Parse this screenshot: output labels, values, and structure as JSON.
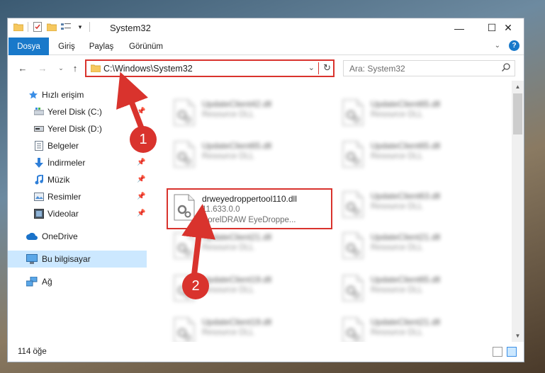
{
  "window": {
    "title": "System32",
    "controls": {
      "minimize": "—",
      "maximize": "☐",
      "close": "✕"
    }
  },
  "ribbon": {
    "tabs": [
      {
        "label": "Dosya",
        "active": true
      },
      {
        "label": "Giriş",
        "active": false
      },
      {
        "label": "Paylaş",
        "active": false
      },
      {
        "label": "Görünüm",
        "active": false
      }
    ],
    "help": "?"
  },
  "address_bar": {
    "path": "C:\\Windows\\System32",
    "dropdown": "⌄",
    "refresh": "↻"
  },
  "search": {
    "placeholder": "Ara: System32"
  },
  "sidebar": {
    "items": [
      {
        "label": "Hızlı erişim",
        "icon": "star-icon"
      },
      {
        "label": "Yerel Disk (C:)",
        "icon": "drive-icon",
        "pinned": true
      },
      {
        "label": "Yerel Disk (D:)",
        "icon": "drive-icon"
      },
      {
        "label": "Belgeler",
        "icon": "documents-icon",
        "pinned": true
      },
      {
        "label": "İndirmeler",
        "icon": "downloads-icon",
        "pinned": true
      },
      {
        "label": "Müzik",
        "icon": "music-icon",
        "pinned": true
      },
      {
        "label": "Resimler",
        "icon": "pictures-icon",
        "pinned": true
      },
      {
        "label": "Videolar",
        "icon": "videos-icon",
        "pinned": true
      },
      {
        "label": "OneDrive",
        "icon": "cloud-icon"
      },
      {
        "label": "Bu bilgisayar",
        "icon": "computer-icon",
        "selected": true
      },
      {
        "label": "Ağ",
        "icon": "network-icon"
      }
    ]
  },
  "files": {
    "left_column": [
      {
        "name": "UpdateClient42.dll",
        "desc": "Resource DLL"
      },
      {
        "name": "UpdateClient65.dll",
        "desc": "Resource DLL"
      },
      {
        "name": "drweyedroppertool110.dll",
        "desc": "11.633.0.0",
        "desc2": "CorelDRAW EyeDroppe...",
        "highlighted": true
      },
      {
        "name": "UpdateClient21.dll",
        "desc": "Resource DLL"
      },
      {
        "name": "UpdateClient19.dll",
        "desc": "Resource DLL"
      },
      {
        "name": "UpdateClient19.dll",
        "desc": "Resource DLL"
      }
    ],
    "right_column": [
      {
        "name": "UpdateClient65.dll",
        "desc": "Resource DLL"
      },
      {
        "name": "UpdateClient65.dll",
        "desc": "Resource DLL"
      },
      {
        "name": "UpdateClient63.dll",
        "desc": "Resource DLL"
      },
      {
        "name": "UpdateClient21.dll",
        "desc": "Resource DLL"
      },
      {
        "name": "UpdateClient65.dll",
        "desc": "Resource DLL"
      },
      {
        "name": "UpdateClient21.dll",
        "desc": "Resource DLL"
      }
    ]
  },
  "status": {
    "item_count": "114 öğe"
  },
  "annotations": [
    {
      "label": "1",
      "color": "#d9332d"
    },
    {
      "label": "2",
      "color": "#d9332d"
    }
  ],
  "colors": {
    "accent": "#1979ca",
    "annotation": "#d9332d",
    "selection": "#cce8ff"
  }
}
